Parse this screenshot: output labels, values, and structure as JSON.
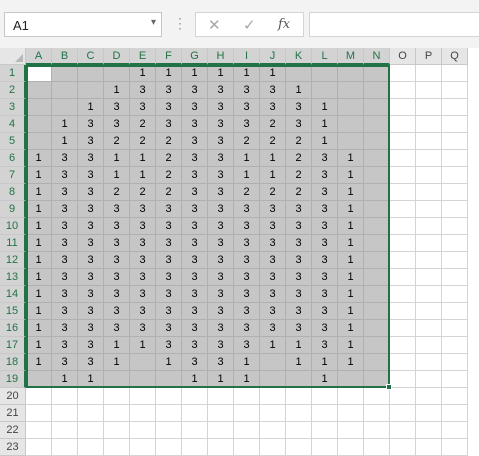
{
  "formula_bar": {
    "name_box": "A1",
    "name_box_caret": "▾",
    "separator_dots": "⋮",
    "cancel_icon": "✕",
    "enter_icon": "✓",
    "function_icon": "fx",
    "formula": ""
  },
  "sheet": {
    "columns": [
      "A",
      "B",
      "C",
      "D",
      "E",
      "F",
      "G",
      "H",
      "I",
      "J",
      "K",
      "L",
      "M",
      "N",
      "O",
      "P",
      "Q"
    ],
    "rows": [
      "1",
      "2",
      "3",
      "4",
      "5",
      "6",
      "7",
      "8",
      "9",
      "10",
      "11",
      "12",
      "13",
      "14",
      "15",
      "16",
      "17",
      "18",
      "19",
      "20",
      "21",
      "22",
      "23"
    ],
    "selected_range": "A1:N19",
    "active_cell": "A1",
    "selection_color": "#217346",
    "selection_fill": "#c6c6c6",
    "cells": [
      [
        "",
        "",
        "",
        "",
        "1",
        "1",
        "1",
        "1",
        "1",
        "1",
        "",
        "",
        "",
        ""
      ],
      [
        "",
        "",
        "",
        "1",
        "3",
        "3",
        "3",
        "3",
        "3",
        "3",
        "1",
        "",
        "",
        ""
      ],
      [
        "",
        "",
        "1",
        "3",
        "3",
        "3",
        "3",
        "3",
        "3",
        "3",
        "3",
        "1",
        "",
        ""
      ],
      [
        "",
        "1",
        "3",
        "3",
        "2",
        "3",
        "3",
        "3",
        "3",
        "2",
        "3",
        "1",
        "",
        ""
      ],
      [
        "",
        "1",
        "3",
        "2",
        "2",
        "2",
        "3",
        "3",
        "2",
        "2",
        "2",
        "1",
        "",
        ""
      ],
      [
        "1",
        "3",
        "3",
        "1",
        "1",
        "2",
        "3",
        "3",
        "1",
        "1",
        "2",
        "3",
        "1",
        ""
      ],
      [
        "1",
        "3",
        "3",
        "1",
        "1",
        "2",
        "3",
        "3",
        "1",
        "1",
        "2",
        "3",
        "1",
        ""
      ],
      [
        "1",
        "3",
        "3",
        "2",
        "2",
        "2",
        "3",
        "3",
        "2",
        "2",
        "2",
        "3",
        "1",
        ""
      ],
      [
        "1",
        "3",
        "3",
        "3",
        "3",
        "3",
        "3",
        "3",
        "3",
        "3",
        "3",
        "3",
        "1",
        ""
      ],
      [
        "1",
        "3",
        "3",
        "3",
        "3",
        "3",
        "3",
        "3",
        "3",
        "3",
        "3",
        "3",
        "1",
        ""
      ],
      [
        "1",
        "3",
        "3",
        "3",
        "3",
        "3",
        "3",
        "3",
        "3",
        "3",
        "3",
        "3",
        "1",
        ""
      ],
      [
        "1",
        "3",
        "3",
        "3",
        "3",
        "3",
        "3",
        "3",
        "3",
        "3",
        "3",
        "3",
        "1",
        ""
      ],
      [
        "1",
        "3",
        "3",
        "3",
        "3",
        "3",
        "3",
        "3",
        "3",
        "3",
        "3",
        "3",
        "1",
        ""
      ],
      [
        "1",
        "3",
        "3",
        "3",
        "3",
        "3",
        "3",
        "3",
        "3",
        "3",
        "3",
        "3",
        "1",
        ""
      ],
      [
        "1",
        "3",
        "3",
        "3",
        "3",
        "3",
        "3",
        "3",
        "3",
        "3",
        "3",
        "3",
        "1",
        ""
      ],
      [
        "1",
        "3",
        "3",
        "3",
        "3",
        "3",
        "3",
        "3",
        "3",
        "3",
        "3",
        "3",
        "1",
        ""
      ],
      [
        "1",
        "3",
        "3",
        "1",
        "1",
        "3",
        "3",
        "3",
        "3",
        "1",
        "1",
        "3",
        "1",
        ""
      ],
      [
        "1",
        "3",
        "3",
        "1",
        "",
        "1",
        "3",
        "3",
        "1",
        "",
        "1",
        "1",
        "1",
        ""
      ],
      [
        "",
        "1",
        "1",
        "",
        "",
        "",
        "1",
        "1",
        "1",
        "",
        "",
        "1",
        "",
        ""
      ]
    ]
  }
}
